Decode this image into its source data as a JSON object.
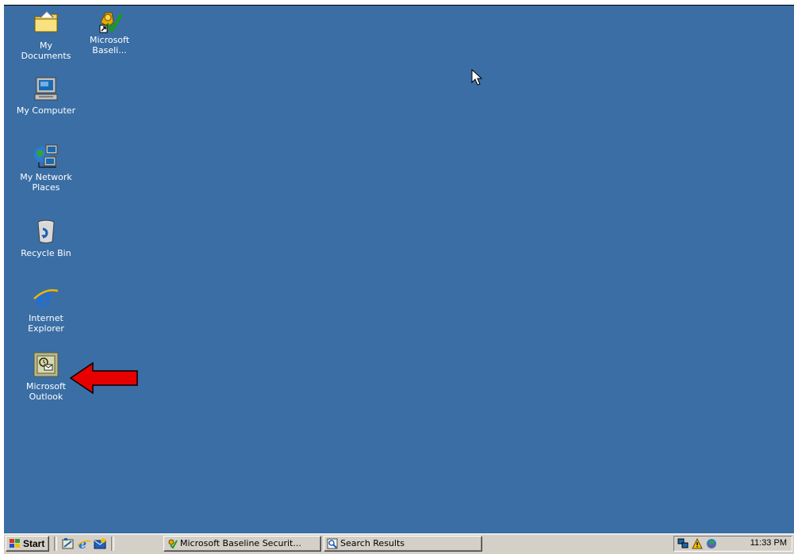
{
  "desktop": {
    "background_color": "#3a6ea5",
    "icons": [
      {
        "label": "My Documents",
        "icon": "folder-documents-icon"
      },
      {
        "label": "Microsoft Baseli...",
        "icon": "baseline-analyzer-icon"
      },
      {
        "label": "My Computer",
        "icon": "computer-icon"
      },
      {
        "label": "My Network Places",
        "icon": "network-places-icon"
      },
      {
        "label": "Recycle Bin",
        "icon": "recycle-bin-icon"
      },
      {
        "label": "Internet Explorer",
        "icon": "internet-explorer-icon"
      },
      {
        "label": "Microsoft Outlook",
        "icon": "outlook-icon"
      }
    ],
    "annotation_arrow_color": "#e60000"
  },
  "taskbar": {
    "start_label": "Start",
    "quick_launch": [
      "desktop-icon",
      "internet-explorer-icon",
      "outlook-express-icon"
    ],
    "tasks": [
      {
        "label": "Microsoft Baseline Securit...",
        "icon": "baseline-analyzer-icon"
      },
      {
        "label": "Search Results",
        "icon": "search-icon"
      }
    ],
    "tray": {
      "icons": [
        "network-icon",
        "alert-icon",
        "windows-update-icon"
      ],
      "clock": "11:33 PM"
    }
  }
}
